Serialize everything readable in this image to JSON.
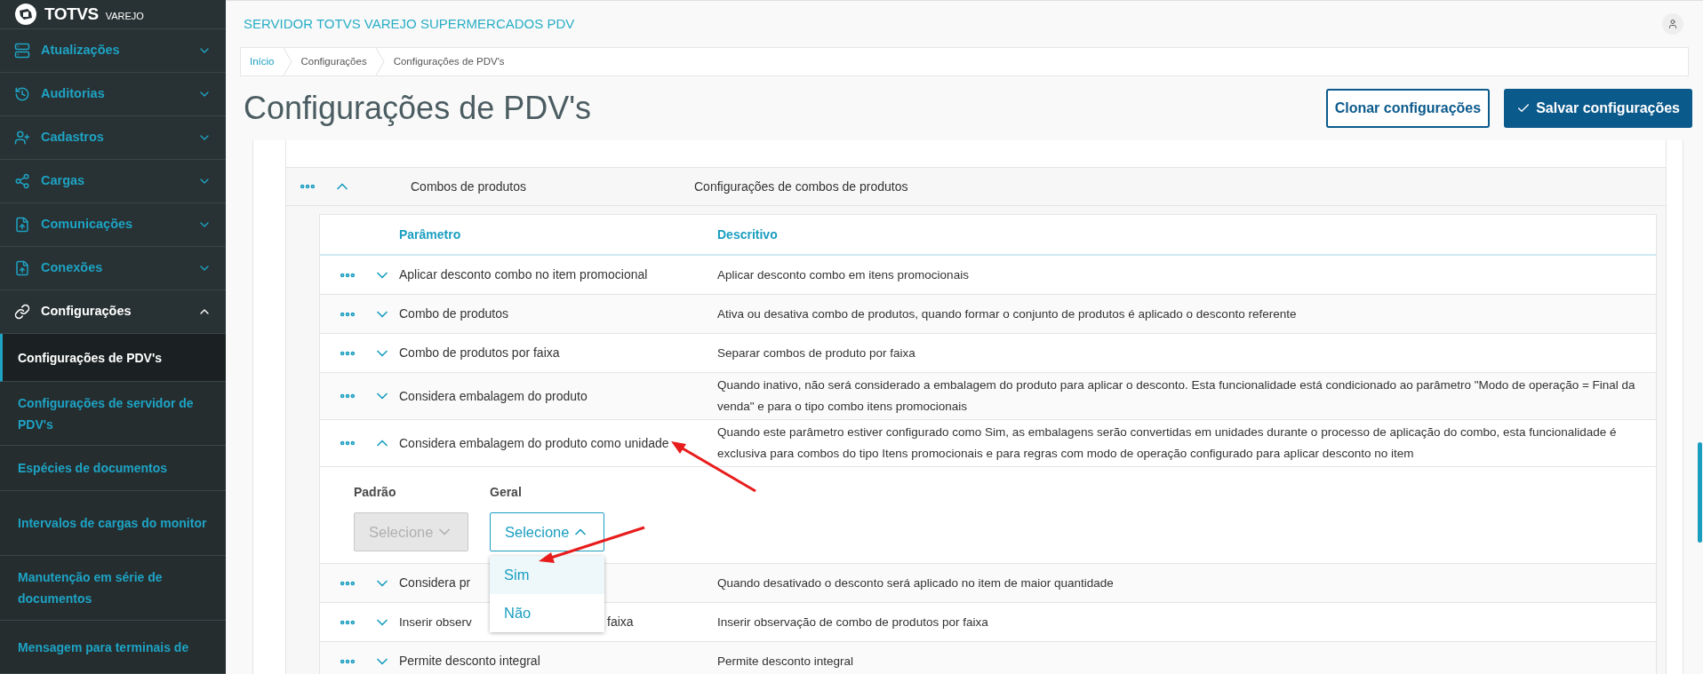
{
  "brand": {
    "name": "TOTVS",
    "sub": "VAREJO"
  },
  "sidebar": {
    "items": [
      {
        "label": "Atualizações",
        "expanded": false
      },
      {
        "label": "Auditorias",
        "expanded": false
      },
      {
        "label": "Cadastros",
        "expanded": false
      },
      {
        "label": "Cargas",
        "expanded": false
      },
      {
        "label": "Comunicações",
        "expanded": false
      },
      {
        "label": "Conexões",
        "expanded": false
      },
      {
        "label": "Configurações",
        "expanded": true,
        "children": [
          {
            "label": "Configurações de PDV's",
            "selected": true
          },
          {
            "label": "Configurações de servidor de PDV's",
            "selected": false
          },
          {
            "label": "Espécies de documentos",
            "selected": false
          },
          {
            "label": "Intervalos de cargas do monitor",
            "selected": false
          },
          {
            "label": "Manutenção em série de documentos",
            "selected": false
          },
          {
            "label": "Mensagem para terminais de",
            "selected": false
          }
        ]
      }
    ]
  },
  "header": {
    "title": "SERVIDOR TOTVS VAREJO SUPERMERCADOS PDV"
  },
  "breadcrumb": [
    "Início",
    "Configurações",
    "Configurações de PDV's"
  ],
  "page_title": "Configurações de PDV's",
  "buttons": [
    {
      "label": "Clonar configurações",
      "kind": "outline"
    },
    {
      "label": "Salvar configurações",
      "kind": "primary"
    }
  ],
  "group": {
    "name": "Combos de produtos",
    "description": "Configurações de combos de produtos",
    "expanded": true,
    "columns": [
      "Parâmetro",
      "Descritivo"
    ],
    "rows": [
      {
        "param": "Aplicar desconto combo no item promocional",
        "description": "Aplicar desconto combo em itens promocionais",
        "expanded": false
      },
      {
        "param": "Combo de produtos",
        "description": "Ativa ou desativa combo de produtos, quando formar o conjunto de produtos é aplicado o desconto referente",
        "expanded": false
      },
      {
        "param": "Combo de produtos por faixa",
        "description": "Separar combos de produto por faixa",
        "expanded": false
      },
      {
        "param": "Considera embalagem do produto",
        "description": "Quando inativo, não será considerado a embalagem do produto para aplicar o desconto. Esta funcionalidade está condicionado ao parâmetro \"Modo de operação = Final da venda\" e para o tipo combo itens promocionais",
        "expanded": false
      },
      {
        "param": "Considera embalagem do produto como unidade",
        "description": "Quando este parâmetro estiver configurado como Sim, as embalagens serão convertidas em unidades durante o processo de aplicação do combo, esta funcionalidade é exclusiva para combos do tipo Itens promocionais e para regras com modo de operação configurado para aplicar desconto no item",
        "expanded": true,
        "fields": [
          {
            "label": "Padrão",
            "value": "Selecione",
            "disabled": true,
            "open": false
          },
          {
            "label": "Geral",
            "value": "Selecione",
            "disabled": false,
            "open": true,
            "options": [
              {
                "label": "Sim",
                "selected": true
              },
              {
                "label": "Não",
                "selected": false
              }
            ]
          }
        ]
      },
      {
        "param": "Considera pr",
        "description": "Quando desativado o desconto será aplicado no item de maior quantidade",
        "expanded": false
      },
      {
        "param": "Inserir observ",
        "param_tail": "faixa",
        "description": "Inserir observação de combo de produtos por faixa",
        "expanded": false
      },
      {
        "param": "Permite desconto integral",
        "description": "Permite desconto integral",
        "expanded": false
      }
    ]
  }
}
